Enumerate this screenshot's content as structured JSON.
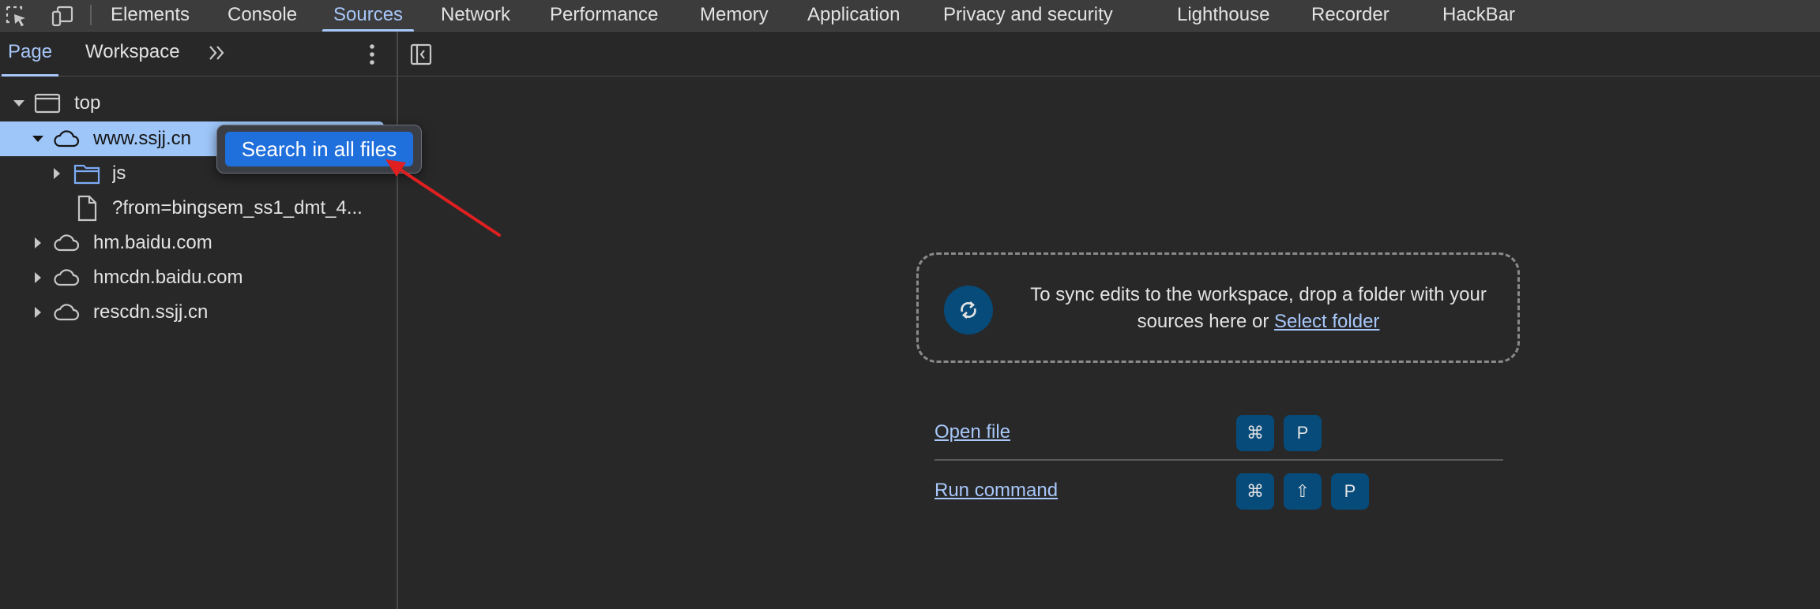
{
  "tabs": [
    {
      "label": "Elements"
    },
    {
      "label": "Console"
    },
    {
      "label": "Sources"
    },
    {
      "label": "Network"
    },
    {
      "label": "Performance"
    },
    {
      "label": "Memory"
    },
    {
      "label": "Application"
    },
    {
      "label": "Privacy and security"
    },
    {
      "label": "Lighthouse"
    },
    {
      "label": "Recorder"
    },
    {
      "label": "HackBar"
    }
  ],
  "active_tab": "Sources",
  "sidebar": {
    "tabs": [
      {
        "label": "Page"
      },
      {
        "label": "Workspace"
      }
    ],
    "active_tab": "Page",
    "tree": [
      {
        "label": "top",
        "icon": "frame-icon",
        "expanded": true
      },
      {
        "label": "www.ssjj.cn",
        "icon": "cloud-icon",
        "expanded": true,
        "selected": true
      },
      {
        "label": "js",
        "icon": "folder-icon",
        "expanded": false
      },
      {
        "label": "?from=bingsem_ss1_dmt_4...",
        "icon": "file-icon"
      },
      {
        "label": "hm.baidu.com",
        "icon": "cloud-icon",
        "expanded": false
      },
      {
        "label": "hmcdn.baidu.com",
        "icon": "cloud-icon",
        "expanded": false
      },
      {
        "label": "rescdn.ssjj.cn",
        "icon": "cloud-icon",
        "expanded": false
      }
    ]
  },
  "popup": {
    "label": "Search in all files"
  },
  "workspace": {
    "sync_text": "To sync edits to the workspace, drop a folder with your sources here or",
    "select_folder": "Select folder"
  },
  "shortcuts": [
    {
      "label": "Open file",
      "keys": [
        "⌘",
        "P"
      ]
    },
    {
      "label": "Run command",
      "keys": [
        "⌘",
        "⇧",
        "P"
      ]
    }
  ],
  "colors": {
    "accent": "#a8c7fa",
    "selected_row": "#9ec6f9",
    "popup_button": "#1f6fdc",
    "key_bg": "#064b7a",
    "annotation_arrow": "#e02020"
  }
}
